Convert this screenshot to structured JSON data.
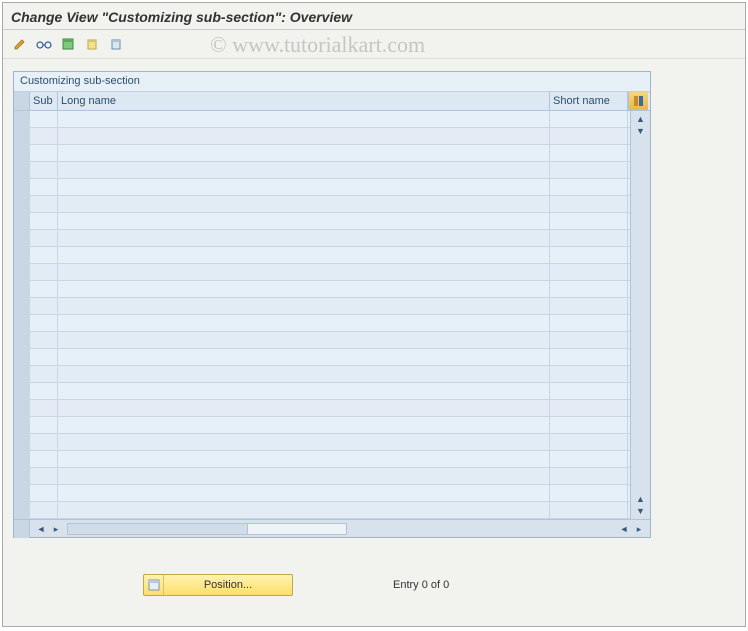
{
  "title": "Change View \"Customizing sub-section\": Overview",
  "watermark": "© www.tutorialkart.com",
  "toolbar": {
    "items": [
      {
        "name": "change-icon"
      },
      {
        "name": "glasses-icon"
      },
      {
        "name": "new-entries-icon"
      },
      {
        "name": "copy-icon"
      },
      {
        "name": "delete-icon"
      }
    ]
  },
  "panel": {
    "header": "Customizing sub-section",
    "columns": {
      "sub": "Sub",
      "long": "Long name",
      "short": "Short name"
    },
    "row_count": 24
  },
  "footer": {
    "position_label": "Position...",
    "entry_text": "Entry 0 of 0"
  }
}
